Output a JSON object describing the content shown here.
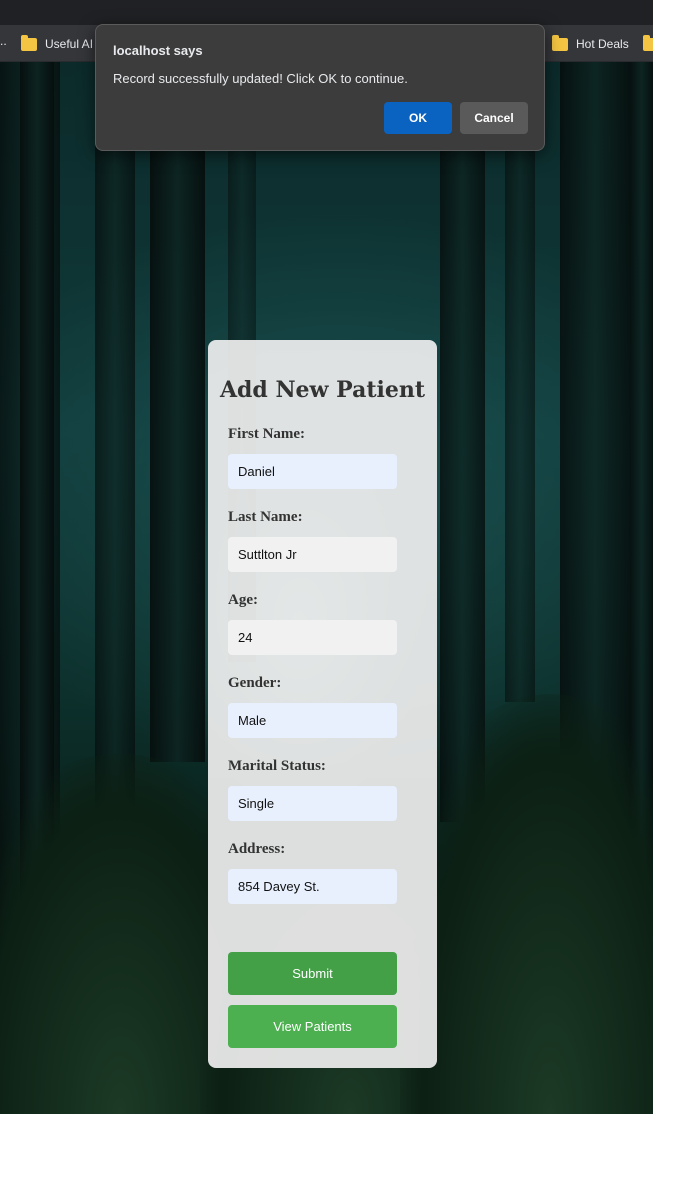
{
  "browser": {
    "bookmarks": [
      {
        "label": "Useful AI",
        "icon": "folder-icon"
      },
      {
        "label": "Hot Deals",
        "icon": "folder-icon"
      }
    ],
    "bookmark_overflow_left": "..",
    "colors": {
      "titlebar": "#202124",
      "bookmarks_bar": "#35363a",
      "folder": "#f4c542"
    }
  },
  "dialog": {
    "title": "localhost says",
    "message": "Record successfully updated! Click OK to continue.",
    "ok_label": "OK",
    "cancel_label": "Cancel",
    "colors": {
      "background": "#3c3c3c",
      "ok": "#0b63c1",
      "cancel": "#5a5a5a"
    }
  },
  "form": {
    "title": "Add New Patient",
    "fields": [
      {
        "label": "First Name:",
        "value": "Daniel"
      },
      {
        "label": "Last Name:",
        "value": "Suttlton Jr"
      },
      {
        "label": "Age:",
        "value": "24"
      },
      {
        "label": "Gender:",
        "value": "Male"
      },
      {
        "label": "Marital Status:",
        "value": "Single"
      },
      {
        "label": "Address:",
        "value": "854 Davey St."
      }
    ],
    "submit_label": "Submit",
    "view_patients_label": "View Patients",
    "colors": {
      "submit": "#43a047",
      "view_patients": "#4caf50",
      "autofill_input": "#e8f0fe"
    }
  }
}
